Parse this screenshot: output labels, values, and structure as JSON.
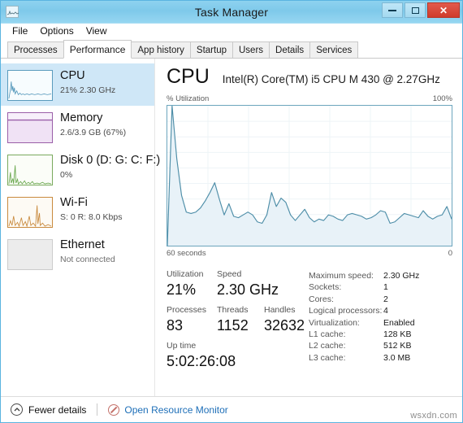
{
  "window": {
    "title": "Task Manager",
    "app_icon": "task-manager-icon",
    "buttons": {
      "minimize": "minimize-icon",
      "maximize": "maximize-icon",
      "close": "✕"
    }
  },
  "menu": {
    "items": [
      "File",
      "Options",
      "View"
    ]
  },
  "tabs": {
    "items": [
      "Processes",
      "Performance",
      "App history",
      "Startup",
      "Users",
      "Details",
      "Services"
    ],
    "active": "Performance"
  },
  "sidebar": {
    "items": [
      {
        "name": "CPU",
        "title": "CPU",
        "sub": "21%  2.30 GHz",
        "selected": true,
        "color": "#5a9bbd"
      },
      {
        "name": "Memory",
        "title": "Memory",
        "sub": "2.6/3.9 GB (67%)",
        "selected": false,
        "color": "#9a5fa8"
      },
      {
        "name": "Disk",
        "title": "Disk 0 (D: G: C: F:)",
        "sub": "0%",
        "selected": false,
        "color": "#7aaa5e"
      },
      {
        "name": "Wi-Fi",
        "title": "Wi-Fi",
        "sub": "S: 0 R: 8.0 Kbps",
        "selected": false,
        "color": "#c98a3e"
      },
      {
        "name": "Ethernet",
        "title": "Ethernet",
        "sub": "Not connected",
        "selected": false,
        "color": "#cccccc"
      }
    ]
  },
  "main": {
    "heading": "CPU",
    "model": "Intel(R) Core(TM) i5 CPU M 430 @ 2.27GHz",
    "chart_axis": {
      "top_left": "% Utilization",
      "top_right": "100%",
      "bottom_left": "60 seconds",
      "bottom_right": "0"
    },
    "stats": {
      "utilization_label": "Utilization",
      "utilization_value": "21%",
      "speed_label": "Speed",
      "speed_value": "2.30 GHz",
      "processes_label": "Processes",
      "processes_value": "83",
      "threads_label": "Threads",
      "threads_value": "1152",
      "handles_label": "Handles",
      "handles_value": "32632",
      "uptime_label": "Up time",
      "uptime_value": "5:02:26:08"
    },
    "details": [
      {
        "key": "Maximum speed:",
        "value": "2.30 GHz"
      },
      {
        "key": "Sockets:",
        "value": "1"
      },
      {
        "key": "Cores:",
        "value": "2"
      },
      {
        "key": "Logical processors:",
        "value": "4"
      },
      {
        "key": "Virtualization:",
        "value": "Enabled"
      },
      {
        "key": "L1 cache:",
        "value": "128 KB"
      },
      {
        "key": "L2 cache:",
        "value": "512 KB"
      },
      {
        "key": "L3 cache:",
        "value": "3.0 MB"
      }
    ]
  },
  "footer": {
    "fewer_details": "Fewer details",
    "fewer_icon": "chevron-up-circle-icon",
    "resource_monitor": "Open Resource Monitor",
    "resource_icon": "resource-monitor-icon"
  },
  "watermark": "wsxdn.com",
  "chart_data": {
    "type": "area",
    "title": "CPU % Utilization",
    "xlabel": "60 seconds",
    "ylabel": "% Utilization",
    "xlim": [
      0,
      60
    ],
    "ylim": [
      0,
      100
    ],
    "grid": true,
    "legend": null,
    "line_color": "#4e8ea8",
    "fill_color": "#e8f2f8",
    "x": [
      0,
      1,
      2,
      3,
      4,
      5,
      6,
      7,
      8,
      9,
      10,
      11,
      12,
      13,
      14,
      15,
      16,
      17,
      18,
      19,
      20,
      21,
      22,
      23,
      24,
      25,
      26,
      27,
      28,
      29,
      30,
      31,
      32,
      33,
      34,
      35,
      36,
      37,
      38,
      39,
      40,
      41,
      42,
      43,
      44,
      45,
      46,
      47,
      48,
      49,
      50,
      51,
      52,
      53,
      54,
      55,
      56,
      57,
      58,
      59,
      60
    ],
    "values": [
      0,
      100,
      62,
      36,
      24,
      23,
      24,
      27,
      32,
      38,
      45,
      33,
      22,
      30,
      21,
      20,
      22,
      24,
      22,
      17,
      16,
      22,
      38,
      28,
      34,
      31,
      22,
      18,
      22,
      26,
      20,
      17,
      19,
      18,
      22,
      21,
      19,
      18,
      22,
      23,
      22,
      21,
      19,
      20,
      22,
      25,
      24,
      16,
      17,
      20,
      23,
      22,
      21,
      20,
      25,
      21,
      19,
      21,
      22,
      28,
      19
    ],
    "series": [
      {
        "name": "% Utilization",
        "values": [
          0,
          100,
          62,
          36,
          24,
          23,
          24,
          27,
          32,
          38,
          45,
          33,
          22,
          30,
          21,
          20,
          22,
          24,
          22,
          17,
          16,
          22,
          38,
          28,
          34,
          31,
          22,
          18,
          22,
          26,
          20,
          17,
          19,
          18,
          22,
          21,
          19,
          18,
          22,
          23,
          22,
          21,
          19,
          20,
          22,
          25,
          24,
          16,
          17,
          20,
          23,
          22,
          21,
          20,
          25,
          21,
          19,
          21,
          22,
          28,
          19
        ]
      }
    ],
    "gridlines_x": 7,
    "gridlines_y": 9
  }
}
